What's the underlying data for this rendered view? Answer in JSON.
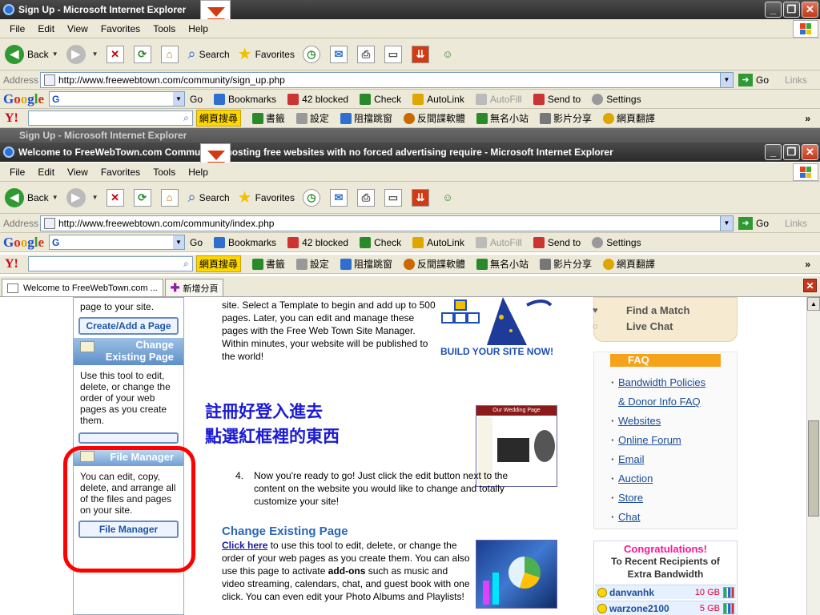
{
  "back_window": {
    "title": "Sign Up - Microsoft Internet Explorer",
    "address": "http://www.freewebtown.com/community/sign_up.php",
    "behind_title": "Sign Up - Microsoft Internet Explorer"
  },
  "front_window": {
    "title": "Welcome to FreeWebTown.com Community - hosting free websites with no forced advertising require - Microsoft Internet Explorer",
    "address": "http://www.freewebtown.com/community/index.php"
  },
  "window_controls": {
    "minimize": "_",
    "restore": "❐",
    "close": "✕"
  },
  "menu": [
    "File",
    "Edit",
    "View",
    "Favorites",
    "Tools",
    "Help"
  ],
  "toolbar": {
    "back": "Back",
    "search": "Search",
    "favorites": "Favorites"
  },
  "address_bar": {
    "label": "Address",
    "go": "Go",
    "links": "Links"
  },
  "google_bar": {
    "logo": [
      "G",
      "o",
      "o",
      "g",
      "l",
      "e"
    ],
    "go": "Go",
    "bookmarks": "Bookmarks",
    "blocked": "42 blocked",
    "check": "Check",
    "autolink": "AutoLink",
    "autofill": "AutoFill",
    "sendto": "Send to",
    "settings": "Settings"
  },
  "yahoo_bar": {
    "logo": "Y!",
    "search_button": "網頁搜尋",
    "items": [
      "書籤",
      "設定",
      "阻擋跳窗",
      "反間諜軟體",
      "無名小站",
      "影片分享",
      "網頁翻譯"
    ]
  },
  "tabs": [
    {
      "label": "Welcome to FreeWebTown.com ...",
      "active": true
    },
    {
      "label": "新增分頁",
      "active": false
    }
  ],
  "sidebar": {
    "top_text": "page to your site.",
    "create_button": "Create/Add a Page",
    "change_header": [
      "Change",
      "Existing Page"
    ],
    "change_text": "Use this tool to edit, delete, or change the order of your web pages as you create them.",
    "file_manager_header": "File Manager",
    "file_manager_text": "You can edit, copy, delete, and arrange all of the files and pages on your site.",
    "file_manager_button": "File Manager"
  },
  "main": {
    "intro": "site. Select a Template to begin and add up to 500 pages. Later, you can edit and manage these pages with the Free Web Town Site Manager. Within minutes, your website will be published to the world!",
    "wizard_caption": "BUILD YOUR SITE NOW!",
    "annotation_line1": "註冊好登入進去",
    "annotation_line2": "點選紅框裡的東西",
    "thumb1_title": "Our Wedding Page",
    "step_number": "4.",
    "step_text": "Now you're ready to go! Just click the edit button next to the content on the website you would like to change and totally customize your site!",
    "change_title": "Change Existing Page",
    "change_link": "Click here",
    "change_text_1": " to use this tool to edit, delete, or change the order of your web pages as you create them. You can also use this page to activate ",
    "change_bold": "add-ons",
    "change_text_2": " such as music and video streaming, calendars, chat, and guest book with one click. You can even edit your Photo Albums and Playlists!"
  },
  "right": {
    "match_items": [
      "Find a Match",
      "Live Chat"
    ],
    "faq_header": "FAQ",
    "faq_links": [
      "Bandwidth Policies",
      "& Donor Info FAQ",
      "Websites",
      "Online Forum",
      "Email",
      "Auction",
      "Store",
      "Chat"
    ],
    "congrats_title": "Congratulations!",
    "congrats_sub": [
      "To Recent Recipients of",
      "Extra Bandwidth"
    ],
    "recipients": [
      {
        "name": "danvanhk",
        "gb": "10 GB"
      },
      {
        "name": "warzone2100",
        "gb": "5 GB"
      }
    ]
  },
  "colors": {
    "annotation": "#1a1ad6",
    "highlight_ring": "#ff0000",
    "faq_header": "#f7a21b",
    "congrats": "#ff1493"
  }
}
